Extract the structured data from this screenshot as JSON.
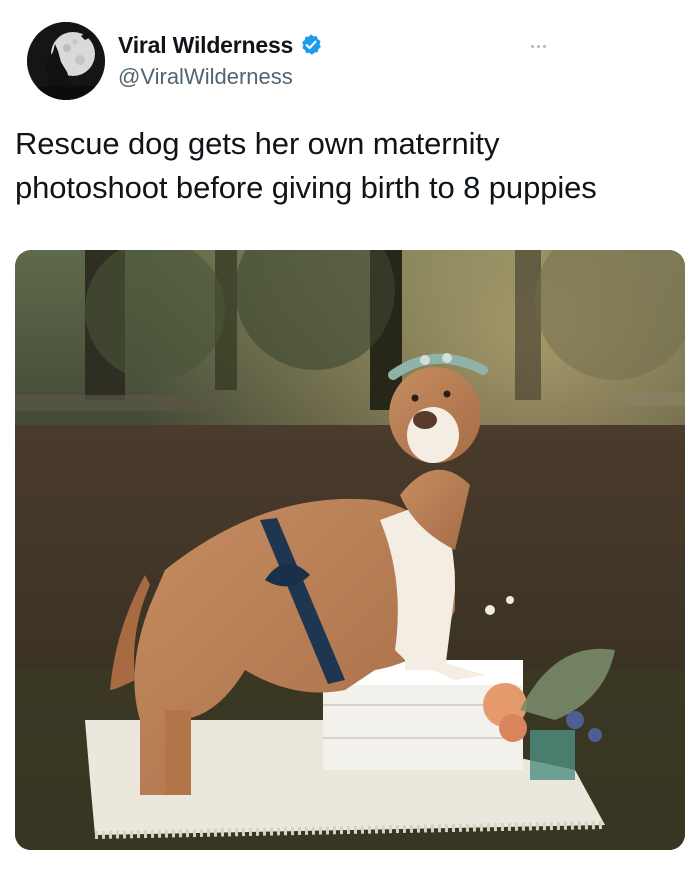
{
  "tweet": {
    "author": {
      "display_name": "Viral Wilderness",
      "handle": "@ViralWilderness",
      "verified": true,
      "avatar_icon": "wolf-howling-moon-icon"
    },
    "more_icon": "more-dots-icon",
    "text": "Rescue dog gets her own maternity\nphotoshoot before giving birth to 8 puppies",
    "media": {
      "type": "photo",
      "icon": "photo-image"
    }
  },
  "colors": {
    "verified_blue": "#1d9bf0",
    "handle_gray": "#536471",
    "text_black": "#0f1419"
  }
}
